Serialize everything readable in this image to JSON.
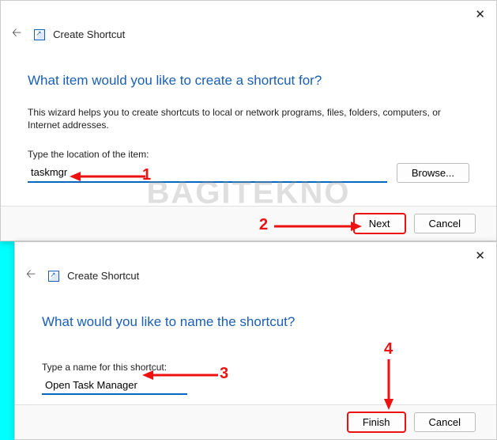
{
  "dialog1": {
    "title": "Create Shortcut",
    "heading": "What item would you like to create a shortcut for?",
    "description": "This wizard helps you to create shortcuts to local or network programs, files, folders, computers, or Internet addresses.",
    "location_label": "Type the location of the item:",
    "location_value": "taskmgr",
    "browse": "Browse...",
    "next": "Next",
    "cancel": "Cancel"
  },
  "dialog2": {
    "title": "Create Shortcut",
    "heading": "What would you like to name the shortcut?",
    "name_label": "Type a name for this shortcut:",
    "name_value": "Open Task Manager",
    "finish": "Finish",
    "cancel": "Cancel"
  },
  "annotations": {
    "n1": "1",
    "n2": "2",
    "n3": "3",
    "n4": "4"
  },
  "watermark": "BAGITEKNO"
}
